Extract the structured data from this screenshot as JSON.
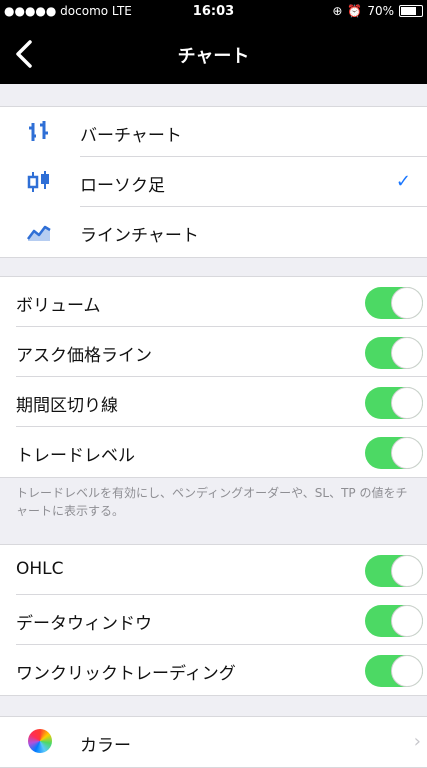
{
  "status": {
    "carrier": "●●●●● docomo  LTE",
    "time": "16:03",
    "battery": "70%"
  },
  "nav": {
    "title": "チャート"
  },
  "chart_type": {
    "items": [
      {
        "label": "バーチャート",
        "icon": "bar-chart-icon",
        "selected": false
      },
      {
        "label": "ローソク足",
        "icon": "candlestick-icon",
        "selected": true
      },
      {
        "label": "ラインチャート",
        "icon": "line-chart-icon",
        "selected": false
      }
    ],
    "checkmark": "✓"
  },
  "toggles_group1": [
    {
      "label": "ボリューム",
      "on": true
    },
    {
      "label": "アスク価格ライン",
      "on": true
    },
    {
      "label": "期間区切り線",
      "on": true
    },
    {
      "label": "トレードレベル",
      "on": true
    }
  ],
  "note": "トレードレベルを有効にし、ペンディングオーダーや、SL、TP の値をチャートに表示する。",
  "toggles_group2": [
    {
      "label": "OHLC",
      "on": true
    },
    {
      "label": "データウィンドウ",
      "on": true
    },
    {
      "label": "ワンクリックトレーディング",
      "on": true
    }
  ],
  "color_row": {
    "label": "カラー",
    "chevron": "›"
  },
  "colors": {
    "toggle_on": "#4cd964",
    "accent": "#1976ff",
    "bar_icon": "#2f6fd6"
  }
}
